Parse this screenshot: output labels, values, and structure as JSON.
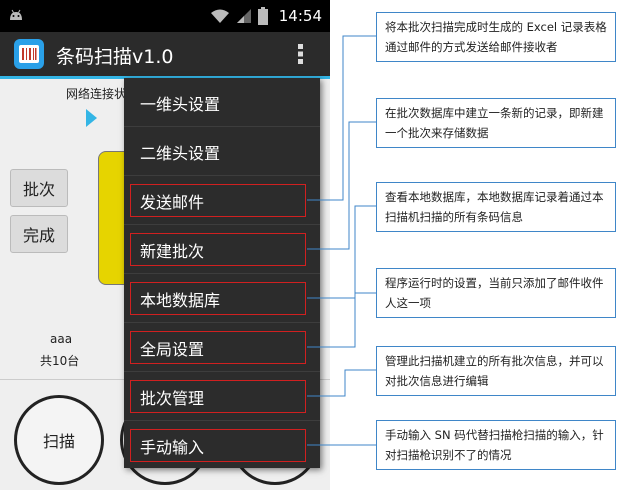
{
  "status_bar": {
    "time": "14:54",
    "icons": [
      "android-icon",
      "wifi-icon",
      "signal-icon",
      "battery-icon"
    ]
  },
  "app_bar": {
    "title": "条码扫描v1.0",
    "logo_icon": "barcode-logo-icon",
    "menu_icon": "overflow-menu-icon"
  },
  "background": {
    "network_label": "网络连接状",
    "batch_button": "批次",
    "complete_button": "完成",
    "info_name": "aaa",
    "info_count": "共10台",
    "scan_button": "扫描"
  },
  "menu": {
    "items": [
      {
        "label": "一维头设置"
      },
      {
        "label": "二维头设置"
      },
      {
        "label": "发送邮件"
      },
      {
        "label": "新建批次"
      },
      {
        "label": "本地数据库"
      },
      {
        "label": "全局设置"
      },
      {
        "label": "批次管理"
      },
      {
        "label": "手动输入"
      }
    ]
  },
  "annotations": [
    {
      "text": "将本批次扫描完成时生成的 Excel 记录表格通过邮件的方式发送给邮件接收者"
    },
    {
      "text": "在批次数据库中建立一条新的记录，即新建一个批次来存储数据"
    },
    {
      "text": "查看本地数据库，本地数据库记录着通过本扫描机扫描的所有条码信息"
    },
    {
      "text": "程序运行时的设置，当前只添加了邮件收件人这一项"
    },
    {
      "text": "管理此扫描机建立的所有批次信息，并可以对批次信息进行编辑"
    },
    {
      "text": "手动输入 SN 码代替扫描枪扫描的输入，针对扫描枪识别不了的情况"
    }
  ],
  "colors": {
    "accent": "#33b5e5",
    "highlight_box": "#d12020",
    "annotation_border": "#3f86c8",
    "menu_bg": "#2c2c2c"
  }
}
